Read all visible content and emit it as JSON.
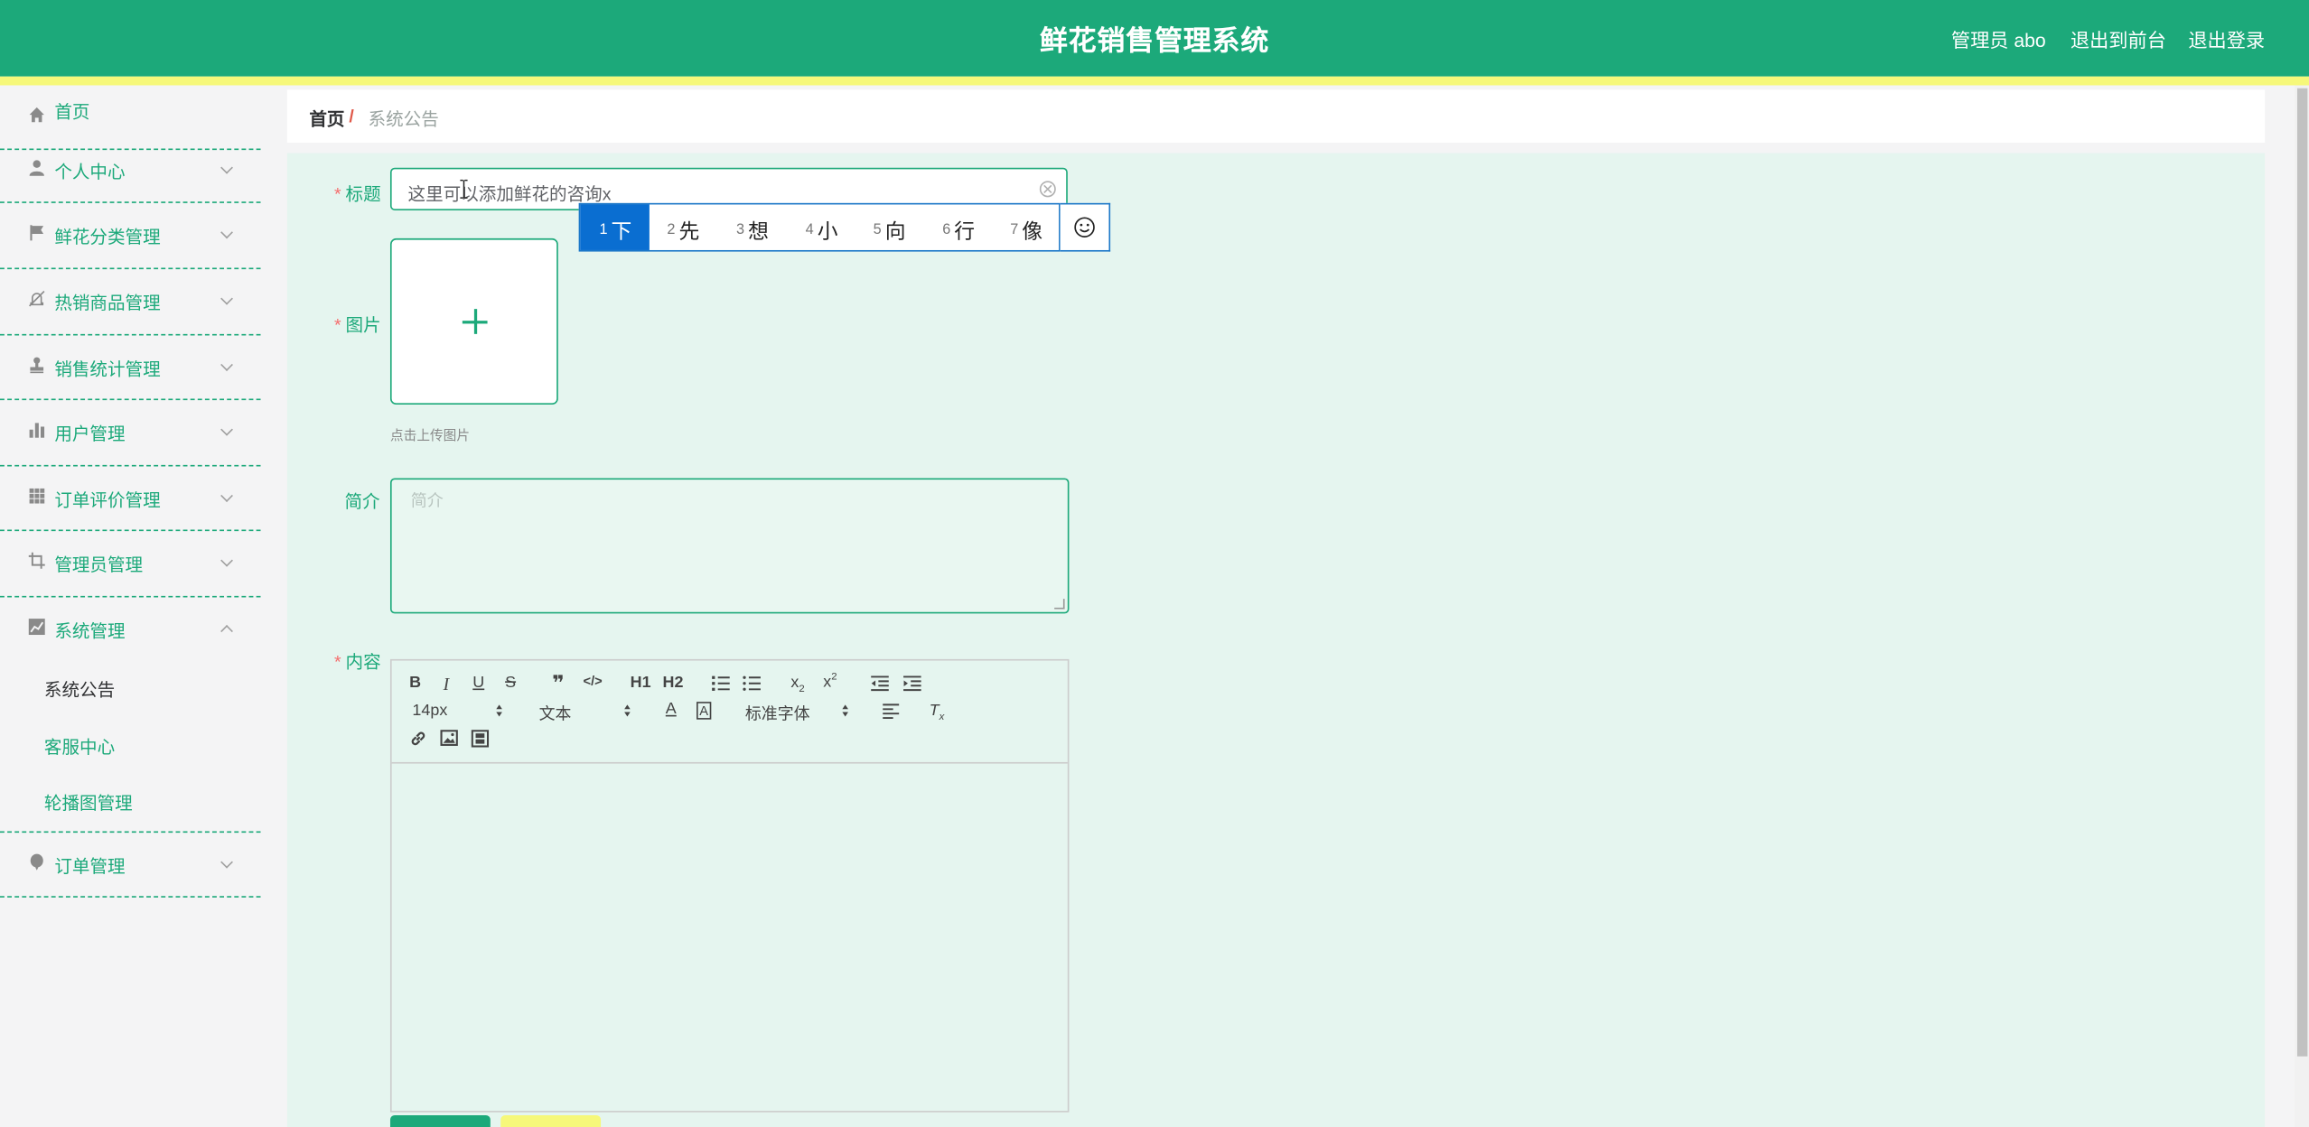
{
  "header": {
    "app_title": "鲜花销售管理系统",
    "user_label": "管理员 abo",
    "to_frontend": "退出到前台",
    "logout": "退出登录"
  },
  "sidebar": {
    "items": [
      {
        "label": "首页",
        "icon": "home-icon"
      },
      {
        "label": "个人中心",
        "icon": "user-icon"
      },
      {
        "label": "鲜花分类管理",
        "icon": "flag-icon"
      },
      {
        "label": "热销商品管理",
        "icon": "bell-off-icon"
      },
      {
        "label": "销售统计管理",
        "icon": "stamp-icon"
      },
      {
        "label": "用户管理",
        "icon": "bar-chart-icon"
      },
      {
        "label": "订单评价管理",
        "icon": "grid-icon"
      },
      {
        "label": "管理员管理",
        "icon": "crop-icon"
      },
      {
        "label": "系统管理",
        "icon": "line-chart-icon"
      },
      {
        "label": "订单管理",
        "icon": "balloon-icon"
      }
    ],
    "sub_items": [
      "系统公告",
      "客服中心",
      "轮播图管理"
    ]
  },
  "breadcrumb": {
    "home": "首页",
    "separator": "/",
    "current": "系统公告"
  },
  "form": {
    "title_label": "标题",
    "title_value": "这里可以添加鲜花的咨询x",
    "image_label": "图片",
    "upload_tip": "点击上传图片",
    "intro_label": "简介",
    "intro_placeholder": "简介",
    "content_label": "内容"
  },
  "ime": {
    "candidates": [
      {
        "num": "1",
        "char": "下"
      },
      {
        "num": "2",
        "char": "先"
      },
      {
        "num": "3",
        "char": "想"
      },
      {
        "num": "4",
        "char": "小"
      },
      {
        "num": "5",
        "char": "向"
      },
      {
        "num": "6",
        "char": "行"
      },
      {
        "num": "7",
        "char": "像"
      }
    ]
  },
  "editor": {
    "size": "14px",
    "block": "文本",
    "font": "标准字体",
    "h1": "H1",
    "h2": "H2"
  },
  "colors": {
    "accent": "#1ca97a",
    "highlight": "#f6f87a",
    "required": "#f56c6c"
  }
}
